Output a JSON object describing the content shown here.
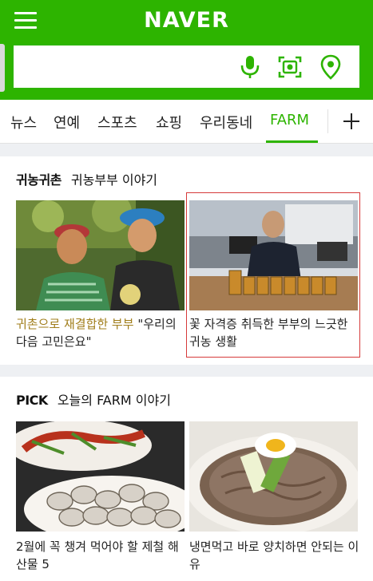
{
  "header": {
    "logo": "NAVER",
    "search_placeholder": "",
    "brand_color": "#2db400"
  },
  "tabs": {
    "items": [
      "뉴스",
      "연예",
      "스포츠",
      "쇼핑",
      "우리동네",
      "FARM"
    ],
    "active": "FARM",
    "add_icon": "plus-icon"
  },
  "section1": {
    "title": "귀농귀촌",
    "subtitle": "귀농부부 이야기",
    "items": [
      {
        "highlight": "귀촌으로 재결합한 부부",
        "text": " \"우리의 다음 고민은요\""
      },
      {
        "highlight": "",
        "text": "꽃 자격증 취득한 부부의 느긋한 귀농 생활"
      }
    ]
  },
  "section2": {
    "title": "PICK",
    "subtitle": "오늘의 FARM 이야기",
    "items": [
      {
        "text": "2월에 꼭 챙겨 먹어야 할 제철 해산물 5"
      },
      {
        "text": "냉면먹고 바로 양치하면 안되는 이유"
      }
    ]
  },
  "icons": [
    "menu-icon",
    "mic-icon",
    "lens-icon",
    "location-pin-icon",
    "plus-icon"
  ]
}
